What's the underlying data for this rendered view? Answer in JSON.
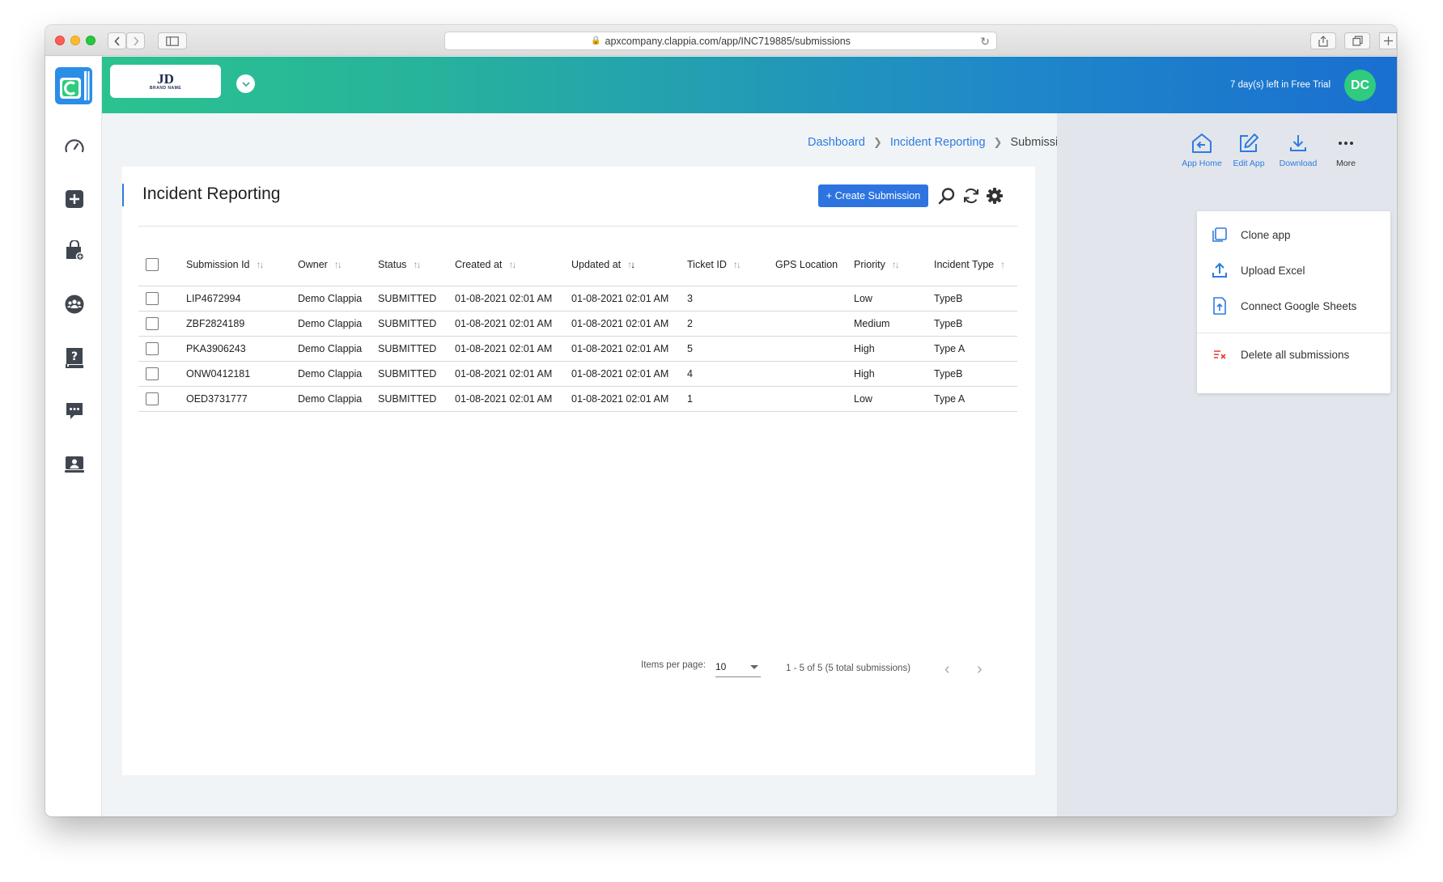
{
  "browser": {
    "url": "apxcompany.clappia.com/app/INC719885/submissions"
  },
  "header": {
    "brand_initials": "JD",
    "brand_name": "BRAND NAME",
    "trial_text": "7 day(s) left in Free Trial",
    "avatar_initials": "DC"
  },
  "breadcrumb": {
    "items": [
      "Dashboard",
      "Incident Reporting",
      "Submissions"
    ]
  },
  "page": {
    "title": "Incident Reporting",
    "create_button": "+ Create Submission"
  },
  "table": {
    "columns": [
      "Submission Id",
      "Owner",
      "Status",
      "Created at",
      "Updated at",
      "Ticket ID",
      "GPS Location",
      "Priority",
      "Incident Type"
    ],
    "rows": [
      [
        "LIP4672994",
        "Demo Clappia",
        "SUBMITTED",
        "01-08-2021 02:01 AM",
        "01-08-2021 02:01 AM",
        "3",
        "",
        "Low",
        "TypeB"
      ],
      [
        "ZBF2824189",
        "Demo Clappia",
        "SUBMITTED",
        "01-08-2021 02:01 AM",
        "01-08-2021 02:01 AM",
        "2",
        "",
        "Medium",
        "TypeB"
      ],
      [
        "PKA3906243",
        "Demo Clappia",
        "SUBMITTED",
        "01-08-2021 02:01 AM",
        "01-08-2021 02:01 AM",
        "5",
        "",
        "High",
        "Type A"
      ],
      [
        "ONW0412181",
        "Demo Clappia",
        "SUBMITTED",
        "01-08-2021 02:01 AM",
        "01-08-2021 02:01 AM",
        "4",
        "",
        "High",
        "TypeB"
      ],
      [
        "OED3731777",
        "Demo Clappia",
        "SUBMITTED",
        "01-08-2021 02:01 AM",
        "01-08-2021 02:01 AM",
        "1",
        "",
        "Low",
        "Type A"
      ]
    ]
  },
  "pagination": {
    "items_per_page_label": "Items per page:",
    "items_per_page_value": "10",
    "range_text": "1 - 5 of 5 (5 total submissions)"
  },
  "toolbar": {
    "app_home": "App Home",
    "edit_app": "Edit App",
    "download": "Download",
    "more": "More"
  },
  "more_menu": {
    "clone_app": "Clone app",
    "upload_excel": "Upload Excel",
    "connect_google_sheets": "Connect Google Sheets",
    "delete_all": "Delete all submissions"
  },
  "colors": {
    "accent": "#2e7be0",
    "avatar": "#2fcb7f",
    "danger": "#e53935"
  },
  "icons": [
    "speedometer-icon",
    "add-app-icon",
    "shopping-bag-icon",
    "team-icon",
    "help-book-icon",
    "chat-icon",
    "support-icon",
    "search-icon",
    "refresh-icon",
    "settings-icon"
  ]
}
